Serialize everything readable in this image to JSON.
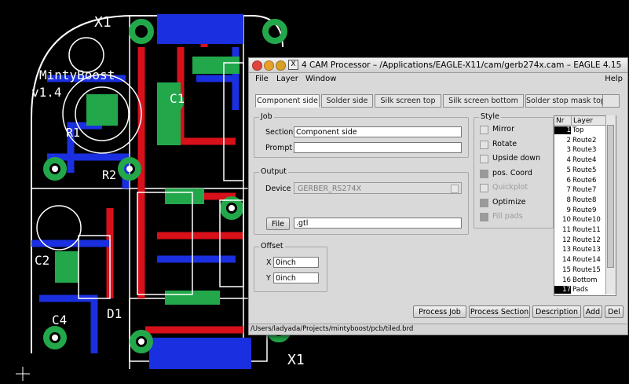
{
  "pcb": {
    "labels": {
      "x1_top": "X1",
      "mintyboost": "MintyBoost",
      "version": "v1.4",
      "r1": "R1",
      "r2": "R2",
      "c1": "C1",
      "c2": "C2",
      "c4": "C4",
      "d1": "D1",
      "x1_bottom": "X1"
    }
  },
  "window": {
    "title": "4 CAM Processor – /Applications/EAGLE-X11/cam/gerb274x.cam – EAGLE 4.15",
    "x_label": "X",
    "menu": {
      "file": "File",
      "layer": "Layer",
      "window": "Window",
      "help": "Help"
    },
    "tabs": [
      "Component side",
      "Solder side",
      "Silk screen top",
      "Silk screen bottom",
      "Solder stop mask top"
    ],
    "job": {
      "group_label": "Job",
      "section_label": "Section",
      "section_value": "Component side",
      "prompt_label": "Prompt",
      "prompt_value": ""
    },
    "output": {
      "group_label": "Output",
      "device_label": "Device",
      "device_value": "GERBER_RS274X",
      "file_button": "File",
      "file_value": ".gtl"
    },
    "offset": {
      "group_label": "Offset",
      "x_label": "X",
      "x_value": "0inch",
      "y_label": "Y",
      "y_value": "0inch"
    },
    "style": {
      "group_label": "Style",
      "options": [
        {
          "label": "Mirror",
          "checked": false,
          "enabled": true
        },
        {
          "label": "Rotate",
          "checked": false,
          "enabled": true
        },
        {
          "label": "Upside down",
          "checked": false,
          "enabled": true
        },
        {
          "label": "pos. Coord",
          "checked": true,
          "enabled": true
        },
        {
          "label": "Quickplot",
          "checked": false,
          "enabled": false
        },
        {
          "label": "Optimize",
          "checked": true,
          "enabled": true
        },
        {
          "label": "Fill pads",
          "checked": true,
          "enabled": false
        }
      ]
    },
    "layers": {
      "headers": {
        "nr": "Nr",
        "layer": "Layer"
      },
      "rows": [
        {
          "nr": "1",
          "name": "Top",
          "selected": true
        },
        {
          "nr": "2",
          "name": "Route2",
          "selected": false
        },
        {
          "nr": "3",
          "name": "Route3",
          "selected": false
        },
        {
          "nr": "4",
          "name": "Route4",
          "selected": false
        },
        {
          "nr": "5",
          "name": "Route5",
          "selected": false
        },
        {
          "nr": "6",
          "name": "Route6",
          "selected": false
        },
        {
          "nr": "7",
          "name": "Route7",
          "selected": false
        },
        {
          "nr": "8",
          "name": "Route8",
          "selected": false
        },
        {
          "nr": "9",
          "name": "Route9",
          "selected": false
        },
        {
          "nr": "10",
          "name": "Route10",
          "selected": false
        },
        {
          "nr": "11",
          "name": "Route11",
          "selected": false
        },
        {
          "nr": "12",
          "name": "Route12",
          "selected": false
        },
        {
          "nr": "13",
          "name": "Route13",
          "selected": false
        },
        {
          "nr": "14",
          "name": "Route14",
          "selected": false
        },
        {
          "nr": "15",
          "name": "Route15",
          "selected": false
        },
        {
          "nr": "16",
          "name": "Bottom",
          "selected": false
        },
        {
          "nr": "17",
          "name": "Pads",
          "selected": true
        }
      ]
    },
    "buttons": {
      "process_job": "Process Job",
      "process_section": "Process Section",
      "description": "Description",
      "add": "Add",
      "del": "Del"
    },
    "status_path": "/Users/ladyada/Projects/mintyboost/pcb/tiled.brd"
  },
  "colors": {
    "pcb_background": "#000000",
    "trace_red": "#d8101a",
    "trace_blue": "#1a2fe0",
    "pad_green": "#22a84a",
    "silkscreen": "#ffffff",
    "dialog": "#d9d9d9"
  }
}
